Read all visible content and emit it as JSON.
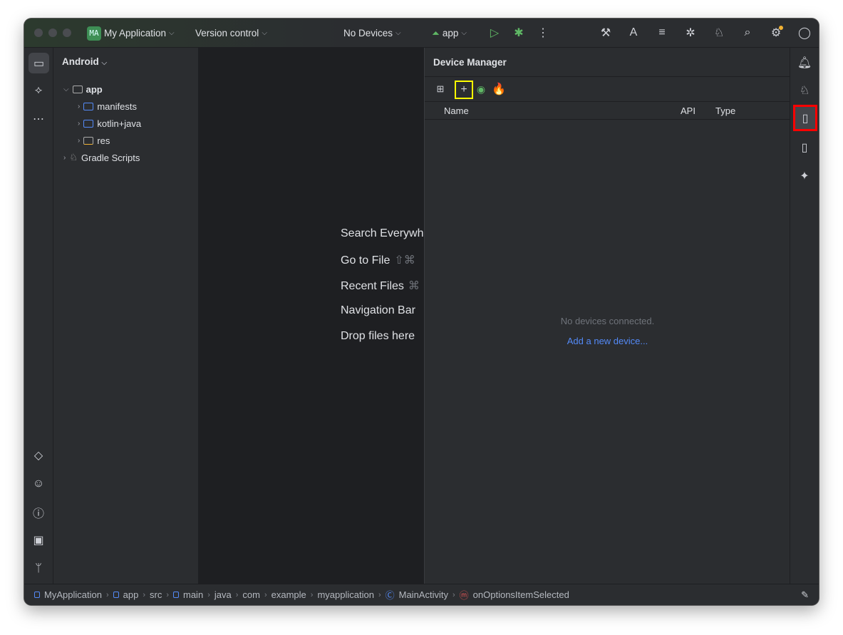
{
  "titlebar": {
    "project_badge": "MA",
    "project_name": "My Application",
    "vcs": "Version control",
    "devices": "No Devices",
    "run_config": "app"
  },
  "toolbar_icons": [
    "build-run-icon",
    "translate-icon",
    "sync-list-icon",
    "debug-attach-icon",
    "gradle-sync-icon",
    "search-icon",
    "settings-icon",
    "account-icon"
  ],
  "project": {
    "view": "Android",
    "tree": [
      {
        "label": "app",
        "level": 0,
        "expanded": true
      },
      {
        "label": "manifests",
        "level": 1
      },
      {
        "label": "kotlin+java",
        "level": 1
      },
      {
        "label": "res",
        "level": 1
      },
      {
        "label": "Gradle Scripts",
        "level": 0
      }
    ]
  },
  "editor": {
    "hints": [
      {
        "label": "Search Everywh",
        "shortcut": ""
      },
      {
        "label": "Go to File",
        "shortcut": "⇧⌘"
      },
      {
        "label": "Recent Files",
        "shortcut": "⌘"
      },
      {
        "label": "Navigation Bar",
        "shortcut": ""
      },
      {
        "label": "Drop files here",
        "shortcut": ""
      }
    ]
  },
  "device_manager": {
    "title": "Device Manager",
    "columns": [
      "Name",
      "API",
      "Type"
    ],
    "empty_text": "No devices connected.",
    "add_link": "Add a new device..."
  },
  "breadcrumb": [
    "MyApplication",
    "app",
    "src",
    "main",
    "java",
    "com",
    "example",
    "myapplication",
    "MainActivity",
    "onOptionsItemSelected"
  ],
  "colors": {
    "accent": "#548af7",
    "run_green": "#5fb865",
    "highlight_yellow": "#ffff00",
    "highlight_red": "#ff0000"
  }
}
